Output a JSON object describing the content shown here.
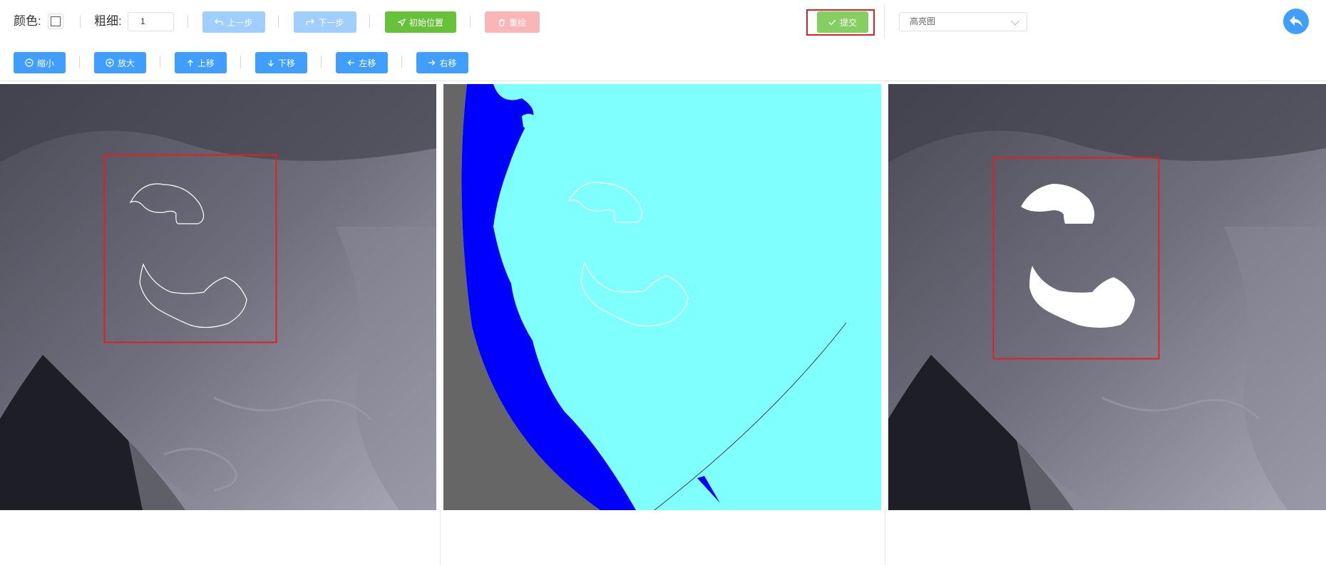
{
  "toolbar": {
    "color_label": "颜色:",
    "thickness_label": "粗细:",
    "thickness_value": "1",
    "undo_label": "上一步",
    "redo_label": "下一步",
    "reset_position_label": "初始位置",
    "redraw_label": "重绘",
    "submit_label": "提交",
    "view_select_value": "高亮图"
  },
  "nav": {
    "zoom_out": "缩小",
    "zoom_in": "放大",
    "move_up": "上移",
    "move_down": "下移",
    "move_left": "左移",
    "move_right": "右移"
  },
  "icons": {
    "undo": "undo-icon",
    "redo": "redo-icon",
    "locate": "navigation-arrow-icon",
    "delete": "trash-icon",
    "check": "check-icon",
    "back": "return-arrow-icon",
    "zoom_out": "minus-circle-icon",
    "zoom_in": "plus-circle-icon",
    "up": "arrow-up-icon",
    "down": "arrow-down-icon",
    "left": "arrow-left-icon",
    "right": "arrow-right-icon"
  },
  "colors": {
    "primary": "#409eff",
    "primary_disabled": "#a0cfff",
    "success": "#67c23a",
    "danger_light": "#fab6b6",
    "highlight_frame": "#e02020",
    "mask_ice": "#80ffff",
    "mask_land": "#0000ff",
    "mask_background": "#666666"
  }
}
